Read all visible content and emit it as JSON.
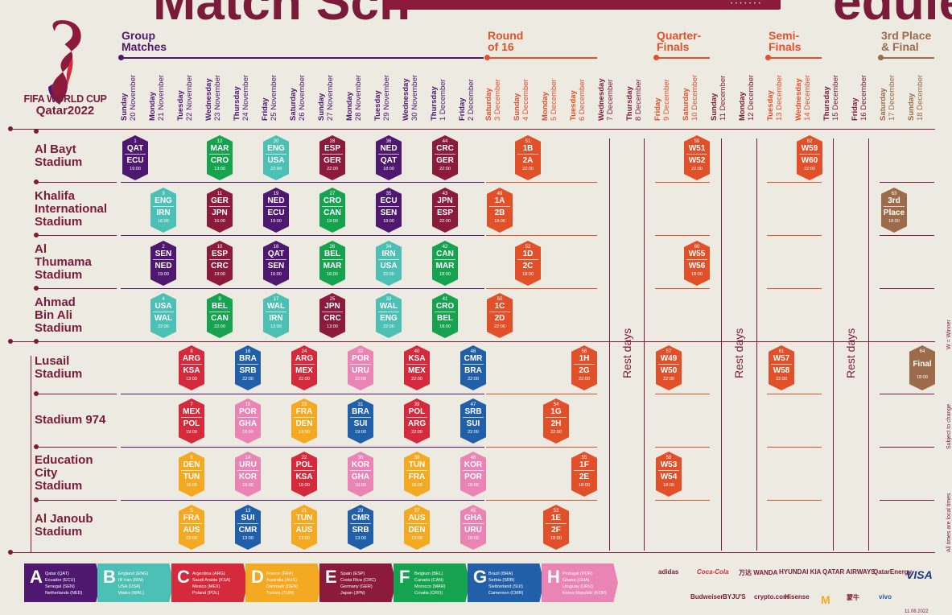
{
  "title": {
    "left": "Match Sch",
    "right": "edule",
    "bar_dots": "• • • • • • •"
  },
  "logo": {
    "line1": "FIFA WORLD CUP",
    "line2": "Qatar2022"
  },
  "phases": [
    {
      "label": "Group\nMatches",
      "color": "#4e1870"
    },
    {
      "label": "Round\nof 16",
      "color": "#e2502a"
    },
    {
      "label": "Quarter-\nFinals",
      "color": "#e2502a"
    },
    {
      "label": "Semi-\nFinals",
      "color": "#e2502a"
    },
    {
      "label": "3rd Place\n& Final",
      "color": "#9b6b4a"
    }
  ],
  "days": [
    {
      "w": "Sunday",
      "d": "20 November",
      "c": "#4e1870"
    },
    {
      "w": "Monday",
      "d": "21 November",
      "c": "#4e1870"
    },
    {
      "w": "Tuesday",
      "d": "22 November",
      "c": "#4e1870"
    },
    {
      "w": "Wednesday",
      "d": "23 November",
      "c": "#4e1870"
    },
    {
      "w": "Thursday",
      "d": "24 November",
      "c": "#4e1870"
    },
    {
      "w": "Friday",
      "d": "25 November",
      "c": "#4e1870"
    },
    {
      "w": "Saturday",
      "d": "26 November",
      "c": "#4e1870"
    },
    {
      "w": "Sunday",
      "d": "27 November",
      "c": "#4e1870"
    },
    {
      "w": "Monday",
      "d": "28 November",
      "c": "#4e1870"
    },
    {
      "w": "Tuesday",
      "d": "29 November",
      "c": "#4e1870"
    },
    {
      "w": "Wednesday",
      "d": "30 November",
      "c": "#4e1870"
    },
    {
      "w": "Thursday",
      "d": "1 December",
      "c": "#4e1870"
    },
    {
      "w": "Friday",
      "d": "2 December",
      "c": "#4e1870"
    },
    {
      "w": "Saturday",
      "d": "3 December",
      "c": "#e2502a"
    },
    {
      "w": "Sunday",
      "d": "4 December",
      "c": "#e2502a"
    },
    {
      "w": "Monday",
      "d": "5 December",
      "c": "#e2502a"
    },
    {
      "w": "Tuesday",
      "d": "6 December",
      "c": "#e2502a"
    },
    {
      "w": "Wednesday",
      "d": "7 December",
      "c": "#7a1b3a"
    },
    {
      "w": "Thursday",
      "d": "8 December",
      "c": "#7a1b3a"
    },
    {
      "w": "Friday",
      "d": "9 December",
      "c": "#e2502a"
    },
    {
      "w": "Saturday",
      "d": "10 December",
      "c": "#e2502a"
    },
    {
      "w": "Sunday",
      "d": "11 December",
      "c": "#7a1b3a"
    },
    {
      "w": "Monday",
      "d": "12 December",
      "c": "#7a1b3a"
    },
    {
      "w": "Tuesday",
      "d": "13 December",
      "c": "#e2502a"
    },
    {
      "w": "Wednesday",
      "d": "14 December",
      "c": "#e2502a"
    },
    {
      "w": "Thursday",
      "d": "15 December",
      "c": "#7a1b3a"
    },
    {
      "w": "Friday",
      "d": "16 December",
      "c": "#7a1b3a"
    },
    {
      "w": "Saturday",
      "d": "17 December",
      "c": "#9b6b4a"
    },
    {
      "w": "Sunday",
      "d": "18 December",
      "c": "#9b6b4a"
    }
  ],
  "venues": [
    "Al Bayt\nStadium",
    "Khalifa\nInternational\nStadium",
    "Al\nThumama\nStadium",
    "Ahmad\nBin Ali\nStadium",
    "Lusail\nStadium",
    "Stadium 974",
    "Education\nCity\nStadium",
    "Al Janoub\nStadium"
  ],
  "group_colors": {
    "A": "#4e1870",
    "B": "#4cc0b5",
    "C": "#d42a3c",
    "D": "#f4a922",
    "E": "#8b1a3c",
    "F": "#16a34f",
    "G": "#2160a8",
    "H": "#ea84b4",
    "K": "#e2502a",
    "F3": "#9b6b4a"
  },
  "matches": [
    {
      "n": "1",
      "a": "QAT",
      "b": "ECU",
      "t": "19:00",
      "g": "A",
      "v": 0,
      "d": 0
    },
    {
      "n": "12",
      "a": "MAR",
      "b": "CRO",
      "t": "13:00",
      "g": "F",
      "v": 0,
      "d": 3
    },
    {
      "n": "20",
      "a": "ENG",
      "b": "USA",
      "t": "22:00",
      "g": "B",
      "v": 0,
      "d": 5
    },
    {
      "n": "28",
      "a": "ESP",
      "b": "GER",
      "t": "22:00",
      "g": "E",
      "v": 0,
      "d": 7
    },
    {
      "n": "36",
      "a": "NED",
      "b": "QAT",
      "t": "18:00",
      "g": "A",
      "v": 0,
      "d": 9
    },
    {
      "n": "44",
      "a": "CRC",
      "b": "GER",
      "t": "22:00",
      "g": "E",
      "v": 0,
      "d": 11
    },
    {
      "n": "51",
      "a": "1B",
      "b": "2A",
      "t": "22:00",
      "g": "K",
      "v": 0,
      "d": 14
    },
    {
      "n": "59",
      "a": "W51",
      "b": "W52",
      "t": "22:00",
      "g": "K",
      "v": 0,
      "d": 20
    },
    {
      "n": "62",
      "a": "W59",
      "b": "W60",
      "t": "22:00",
      "g": "K",
      "v": 0,
      "d": 24
    },
    {
      "n": "3",
      "a": "ENG",
      "b": "IRN",
      "t": "16:00",
      "g": "B",
      "v": 1,
      "d": 1
    },
    {
      "n": "11",
      "a": "GER",
      "b": "JPN",
      "t": "16:00",
      "g": "E",
      "v": 1,
      "d": 3
    },
    {
      "n": "19",
      "a": "NED",
      "b": "ECU",
      "t": "19:00",
      "g": "A",
      "v": 1,
      "d": 5
    },
    {
      "n": "27",
      "a": "CRO",
      "b": "CAN",
      "t": "19:00",
      "g": "F",
      "v": 1,
      "d": 7
    },
    {
      "n": "35",
      "a": "ECU",
      "b": "SEN",
      "t": "18:00",
      "g": "A",
      "v": 1,
      "d": 9
    },
    {
      "n": "43",
      "a": "JPN",
      "b": "ESP",
      "t": "22:00",
      "g": "E",
      "v": 1,
      "d": 11
    },
    {
      "n": "49",
      "a": "1A",
      "b": "2B",
      "t": "18:00",
      "g": "K",
      "v": 1,
      "d": 13
    },
    {
      "n": "63",
      "a": "3rd",
      "b": "Place",
      "t": "18:00",
      "g": "F3",
      "v": 1,
      "d": 27
    },
    {
      "n": "2",
      "a": "SEN",
      "b": "NED",
      "t": "19:00",
      "g": "A",
      "v": 2,
      "d": 1
    },
    {
      "n": "10",
      "a": "ESP",
      "b": "CRC",
      "t": "19:00",
      "g": "E",
      "v": 2,
      "d": 3
    },
    {
      "n": "18",
      "a": "QAT",
      "b": "SEN",
      "t": "16:00",
      "g": "A",
      "v": 2,
      "d": 5
    },
    {
      "n": "26",
      "a": "BEL",
      "b": "MAR",
      "t": "16:00",
      "g": "F",
      "v": 2,
      "d": 7
    },
    {
      "n": "34",
      "a": "IRN",
      "b": "USA",
      "t": "22:00",
      "g": "B",
      "v": 2,
      "d": 9
    },
    {
      "n": "42",
      "a": "CAN",
      "b": "MAR",
      "t": "18:00",
      "g": "F",
      "v": 2,
      "d": 11
    },
    {
      "n": "52",
      "a": "1D",
      "b": "2C",
      "t": "18:00",
      "g": "K",
      "v": 2,
      "d": 14
    },
    {
      "n": "60",
      "a": "W55",
      "b": "W56",
      "t": "18:00",
      "g": "K",
      "v": 2,
      "d": 20
    },
    {
      "n": "4",
      "a": "USA",
      "b": "WAL",
      "t": "22:00",
      "g": "B",
      "v": 3,
      "d": 1
    },
    {
      "n": "9",
      "a": "BEL",
      "b": "CAN",
      "t": "22:00",
      "g": "F",
      "v": 3,
      "d": 3
    },
    {
      "n": "17",
      "a": "WAL",
      "b": "IRN",
      "t": "13:00",
      "g": "B",
      "v": 3,
      "d": 5
    },
    {
      "n": "25",
      "a": "JPN",
      "b": "CRC",
      "t": "13:00",
      "g": "E",
      "v": 3,
      "d": 7
    },
    {
      "n": "33",
      "a": "WAL",
      "b": "ENG",
      "t": "22:00",
      "g": "B",
      "v": 3,
      "d": 9
    },
    {
      "n": "41",
      "a": "CRO",
      "b": "BEL",
      "t": "18:00",
      "g": "F",
      "v": 3,
      "d": 11
    },
    {
      "n": "50",
      "a": "1C",
      "b": "2D",
      "t": "22:00",
      "g": "K",
      "v": 3,
      "d": 13
    },
    {
      "n": "8",
      "a": "ARG",
      "b": "KSA",
      "t": "13:00",
      "g": "C",
      "v": 4,
      "d": 2
    },
    {
      "n": "16",
      "a": "BRA",
      "b": "SRB",
      "t": "22:00",
      "g": "G",
      "v": 4,
      "d": 4
    },
    {
      "n": "24",
      "a": "ARG",
      "b": "MEX",
      "t": "22:00",
      "g": "C",
      "v": 4,
      "d": 6
    },
    {
      "n": "32",
      "a": "POR",
      "b": "URU",
      "t": "22:00",
      "g": "H",
      "v": 4,
      "d": 8
    },
    {
      "n": "40",
      "a": "KSA",
      "b": "MEX",
      "t": "22:00",
      "g": "C",
      "v": 4,
      "d": 10
    },
    {
      "n": "48",
      "a": "CMR",
      "b": "BRA",
      "t": "22:00",
      "g": "G",
      "v": 4,
      "d": 12
    },
    {
      "n": "56",
      "a": "1H",
      "b": "2G",
      "t": "22:00",
      "g": "K",
      "v": 4,
      "d": 16
    },
    {
      "n": "57",
      "a": "W49",
      "b": "W50",
      "t": "22:00",
      "g": "K",
      "v": 4,
      "d": 19
    },
    {
      "n": "61",
      "a": "W57",
      "b": "W58",
      "t": "22:00",
      "g": "K",
      "v": 4,
      "d": 23
    },
    {
      "n": "64",
      "a": "Final",
      "b": "",
      "t": "18:00",
      "g": "F3",
      "v": 4,
      "d": 28
    },
    {
      "n": "7",
      "a": "MEX",
      "b": "POL",
      "t": "19:00",
      "g": "C",
      "v": 5,
      "d": 2
    },
    {
      "n": "15",
      "a": "POR",
      "b": "GHA",
      "t": "19:00",
      "g": "H",
      "v": 5,
      "d": 4
    },
    {
      "n": "23",
      "a": "FRA",
      "b": "DEN",
      "t": "19:00",
      "g": "D",
      "v": 5,
      "d": 6
    },
    {
      "n": "31",
      "a": "BRA",
      "b": "SUI",
      "t": "19:00",
      "g": "G",
      "v": 5,
      "d": 8
    },
    {
      "n": "39",
      "a": "POL",
      "b": "ARG",
      "t": "22:00",
      "g": "C",
      "v": 5,
      "d": 10
    },
    {
      "n": "47",
      "a": "SRB",
      "b": "SUI",
      "t": "22:00",
      "g": "G",
      "v": 5,
      "d": 12
    },
    {
      "n": "54",
      "a": "1G",
      "b": "2H",
      "t": "22:00",
      "g": "K",
      "v": 5,
      "d": 15
    },
    {
      "n": "6",
      "a": "DEN",
      "b": "TUN",
      "t": "16:00",
      "g": "D",
      "v": 6,
      "d": 2
    },
    {
      "n": "14",
      "a": "URU",
      "b": "KOR",
      "t": "16:00",
      "g": "H",
      "v": 6,
      "d": 4
    },
    {
      "n": "22",
      "a": "POL",
      "b": "KSA",
      "t": "16:00",
      "g": "C",
      "v": 6,
      "d": 6
    },
    {
      "n": "30",
      "a": "KOR",
      "b": "GHA",
      "t": "16:00",
      "g": "H",
      "v": 6,
      "d": 8
    },
    {
      "n": "38",
      "a": "TUN",
      "b": "FRA",
      "t": "18:00",
      "g": "D",
      "v": 6,
      "d": 10
    },
    {
      "n": "46",
      "a": "KOR",
      "b": "POR",
      "t": "18:00",
      "g": "H",
      "v": 6,
      "d": 12
    },
    {
      "n": "55",
      "a": "1F",
      "b": "2E",
      "t": "18:00",
      "g": "K",
      "v": 6,
      "d": 16
    },
    {
      "n": "58",
      "a": "W53",
      "b": "W54",
      "t": "18:00",
      "g": "K",
      "v": 6,
      "d": 19
    },
    {
      "n": "5",
      "a": "FRA",
      "b": "AUS",
      "t": "22:00",
      "g": "D",
      "v": 7,
      "d": 2
    },
    {
      "n": "13",
      "a": "SUI",
      "b": "CMR",
      "t": "13:00",
      "g": "G",
      "v": 7,
      "d": 4
    },
    {
      "n": "21",
      "a": "TUN",
      "b": "AUS",
      "t": "13:00",
      "g": "D",
      "v": 7,
      "d": 6
    },
    {
      "n": "29",
      "a": "CMR",
      "b": "SRB",
      "t": "13:00",
      "g": "G",
      "v": 7,
      "d": 8
    },
    {
      "n": "37",
      "a": "AUS",
      "b": "DEN",
      "t": "13:00",
      "g": "D",
      "v": 7,
      "d": 10
    },
    {
      "n": "45",
      "a": "GHA",
      "b": "URU",
      "t": "18:00",
      "g": "H",
      "v": 7,
      "d": 12
    },
    {
      "n": "53",
      "a": "1E",
      "b": "2F",
      "t": "18:00",
      "g": "K",
      "v": 7,
      "d": 15
    }
  ],
  "rest_days": [
    "Rest days",
    "Rest days",
    "Rest days"
  ],
  "legend": [
    {
      "letter": "A",
      "teams": [
        "Qatar (QAT)",
        "Ecuador (ECU)",
        "Senegal (SEN)",
        "Netherlands (NED)"
      ],
      "color": "#4e1870"
    },
    {
      "letter": "B",
      "teams": [
        "England (ENG)",
        "IR Iran (IRN)",
        "USA (USA)",
        "Wales (WAL)"
      ],
      "color": "#4cc0b5"
    },
    {
      "letter": "C",
      "teams": [
        "Argentina (ARG)",
        "Saudi Arabia (KSA)",
        "Mexico (MEX)",
        "Poland (POL)"
      ],
      "color": "#d42a3c"
    },
    {
      "letter": "D",
      "teams": [
        "France (FRA)",
        "Australia (AUS)",
        "Denmark (DEN)",
        "Tunisia (TUN)"
      ],
      "color": "#f4a922"
    },
    {
      "letter": "E",
      "teams": [
        "Spain (ESP)",
        "Costa Rica (CRC)",
        "Germany (GER)",
        "Japan (JPN)"
      ],
      "color": "#8b1a3c"
    },
    {
      "letter": "F",
      "teams": [
        "Belgium (BEL)",
        "Canada (CAN)",
        "Morocco (MAR)",
        "Croatia (CRO)"
      ],
      "color": "#16a34f"
    },
    {
      "letter": "G",
      "teams": [
        "Brazil (BRA)",
        "Serbia (SRB)",
        "Switzerland (SUI)",
        "Cameroon (CMR)"
      ],
      "color": "#2160a8"
    },
    {
      "letter": "H",
      "teams": [
        "Portugal (POR)",
        "Ghana (GHA)",
        "Uruguay (URU)",
        "Korea Republic (KOR)"
      ],
      "color": "#ea84b4"
    }
  ],
  "sponsors": [
    "adidas",
    "Coca-Cola",
    "万达 WANDA",
    "HYUNDAI KIA",
    "QATAR AIRWAYS",
    "QatarEnergy",
    "VISA",
    "Budweiser",
    "BYJU'S",
    "crypto.com",
    "Hisense",
    "M",
    "蒙牛",
    "vivo"
  ],
  "side_notes": {
    "winner": "W = Winner",
    "subject": "Subject to change",
    "local": "All times are local times"
  },
  "footer_date": "11.08.2022"
}
